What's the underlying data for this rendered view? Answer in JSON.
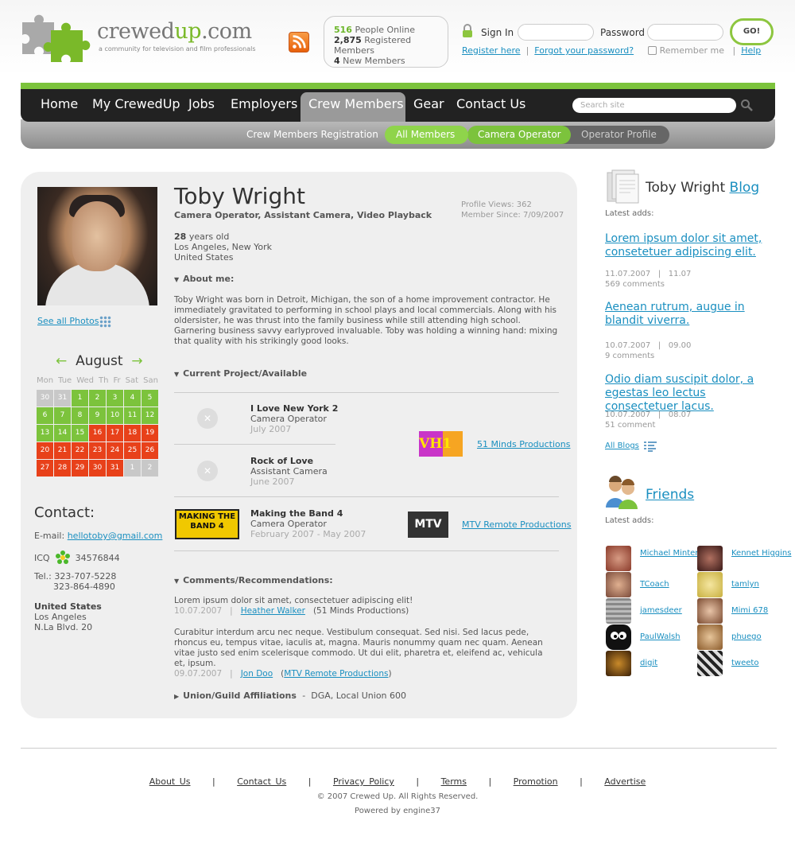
{
  "header": {
    "logo_main": "crewed",
    "logo_accent": "up",
    "logo_domain": ".com",
    "logo_tagline": "a community for television and film professionals",
    "stats": [
      {
        "count": "516",
        "label": "People Online"
      },
      {
        "count": "2,875",
        "label": "Registered Members"
      },
      {
        "count": "4",
        "label": "New Members"
      }
    ],
    "signin_label": "Sign In",
    "password_label": "Password",
    "go_label": "GO!",
    "register_link": "Register here",
    "forgot_link": "Forgot your password?",
    "remember_label": "Remember me",
    "help_link": "Help",
    "separator": "|"
  },
  "nav": {
    "items": [
      "Home",
      "My CrewedUp",
      "Jobs",
      "Employers",
      "Crew Members",
      "Gear",
      "Contact Us"
    ],
    "active": "Crew Members",
    "search_placeholder": "Search site"
  },
  "subnav": {
    "items": [
      "Crew Members Registration",
      "All Members",
      "Camera Operator",
      "Operator Profile"
    ]
  },
  "profile": {
    "name": "Toby Wright",
    "roles": "Camera Operator, Assistant Camera, Video Playback",
    "views": "Profile Views: 362",
    "member_since": "Member Since: 7/09/2007",
    "age_num": "28",
    "age_label": "years old",
    "city": "Los Angeles, New York",
    "country": "United States",
    "see_photos": "See all Photos",
    "about_title": "About me:",
    "about_text": "Toby Wright was born in Detroit, Michigan, the son of a home improvement contractor. He immediately gravitated to performing in school plays and local commercials. Along with his oldersister, he was thrust into the family business while still attending high school. Garnering business savvy earlyproved invaluable. Toby was holding a winning hand: mixing that quality with his strikingly good looks.",
    "project_title": "Current Project/Available",
    "projects": [
      {
        "title": "I Love New York 2",
        "role": "Camera Operator",
        "date": "July 2007"
      },
      {
        "title": "Rock of Love",
        "role": "Assistant Camera",
        "date": "June 2007"
      },
      {
        "title": "Making the Band 4",
        "role": "Camera Operator",
        "date": "February 2007 - May 2007"
      }
    ],
    "companies": [
      {
        "logo": "VH1",
        "name": "51 Minds Productions"
      },
      {
        "logo": "MTV",
        "name": "MTV Remote Productions"
      }
    ],
    "mtb_logo": "MAKING THE BAND 4",
    "comments_title": "Comments/Recommendations:",
    "comments": [
      {
        "text": "Lorem ipsum dolor sit amet, consectetuer adipiscing elit!",
        "date": "10.07.2007",
        "author": "Heather Walker",
        "company": "(51 Minds Productions)"
      },
      {
        "text": "Curabitur interdum arcu nec neque. Vestibulum consequat. Sed nisi. Sed lacus pede, rhoncus eu, tempus vitae, iaculis at, magna. Mauris nonummy quam nec quam. Aenean vitae justo sed enim scelerisque commodo. Ut dui elit, pharetra et, eleifend ac, vehicula et, ipsum.",
        "date": "09.07.2007",
        "author": "Jon Doo",
        "company": "MTV Remote Productions"
      }
    ],
    "union_title": "Union/Guild Affiliations",
    "union_value": "DGA, Local Union 600"
  },
  "calendar": {
    "month": "August",
    "prev": "←",
    "next": "→",
    "dow": [
      "Mon",
      "Tue",
      "Wed",
      "Th",
      "Fr",
      "Sat",
      "San"
    ],
    "days": [
      {
        "d": "30",
        "s": "o"
      },
      {
        "d": "31",
        "s": "o"
      },
      {
        "d": "1",
        "s": "g"
      },
      {
        "d": "2",
        "s": "g"
      },
      {
        "d": "3",
        "s": "g"
      },
      {
        "d": "4",
        "s": "g"
      },
      {
        "d": "5",
        "s": "g"
      },
      {
        "d": "6",
        "s": "g"
      },
      {
        "d": "7",
        "s": "g"
      },
      {
        "d": "8",
        "s": "g"
      },
      {
        "d": "9",
        "s": "g"
      },
      {
        "d": "10",
        "s": "g"
      },
      {
        "d": "11",
        "s": "g"
      },
      {
        "d": "12",
        "s": "g"
      },
      {
        "d": "13",
        "s": "g"
      },
      {
        "d": "14",
        "s": "g"
      },
      {
        "d": "15",
        "s": "g"
      },
      {
        "d": "16",
        "s": "r"
      },
      {
        "d": "17",
        "s": "r"
      },
      {
        "d": "18",
        "s": "r"
      },
      {
        "d": "19",
        "s": "r"
      },
      {
        "d": "20",
        "s": "r"
      },
      {
        "d": "21",
        "s": "r"
      },
      {
        "d": "22",
        "s": "r"
      },
      {
        "d": "23",
        "s": "r"
      },
      {
        "d": "24",
        "s": "r"
      },
      {
        "d": "25",
        "s": "r"
      },
      {
        "d": "26",
        "s": "r"
      },
      {
        "d": "27",
        "s": "r"
      },
      {
        "d": "28",
        "s": "r"
      },
      {
        "d": "29",
        "s": "r"
      },
      {
        "d": "30",
        "s": "r"
      },
      {
        "d": "31",
        "s": "r"
      },
      {
        "d": "1",
        "s": "o"
      },
      {
        "d": "2",
        "s": "o"
      }
    ]
  },
  "contact": {
    "title": "Contact:",
    "email_label": "E-mail:",
    "email": "hellotoby@gmail.com",
    "icq_label": "ICQ",
    "icq": "34576844",
    "tel_label": "Tel.:",
    "tel1": "323-707-5228",
    "tel2": "323-864-4890",
    "country": "United States",
    "city": "Los Angeles",
    "street": "N.La Blvd. 20"
  },
  "blog": {
    "title_name": "Toby Wright",
    "title_link": "Blog",
    "latest": "Latest adds:",
    "posts": [
      {
        "title": "Lorem ipsum dolor sit amet, consetetuer adipiscing elit.",
        "date": "11.07.2007",
        "time": "11.07",
        "comments": "569 comments"
      },
      {
        "title": "Aenean rutrum, augue in blandit viverra.",
        "date": "10.07.2007",
        "time": "09.00",
        "comments": "9 comments"
      },
      {
        "title": "Odio diam suscipit dolor, a egestas leo lectus consectetuer lacus.",
        "date": "10.07.2007",
        "time": "08.07",
        "comments": "51 comment"
      }
    ],
    "all_blogs": "All Blogs"
  },
  "friends": {
    "title": "Friends",
    "latest": "Latest adds:",
    "list": [
      "Michael Minter",
      "Kennet Higgins",
      "TCoach",
      "tamlyn",
      "jamesdeer",
      "Mimi 678",
      "PaulWalsh",
      "phuego",
      "digit",
      "tweeto"
    ]
  },
  "footer": {
    "links": [
      "About Us",
      "Contact Us",
      "Privacy Policy",
      "Terms",
      "Promotion",
      "Advertise"
    ],
    "copyright": "© 2007 Crewed Up. All Rights Reserved.",
    "powered": "Powered by engine37"
  },
  "colors": {
    "accent": "#7cc33c",
    "link": "#1a8fc0",
    "nav": "#222222",
    "hot": "#e8411a"
  }
}
